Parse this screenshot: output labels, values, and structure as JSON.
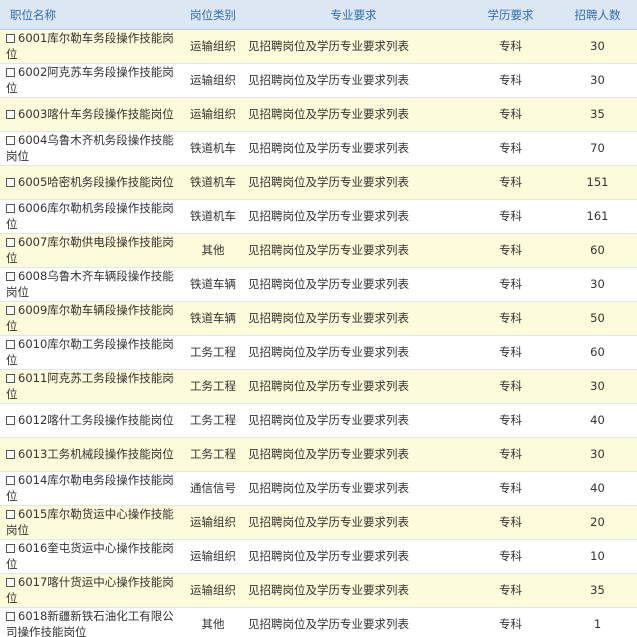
{
  "table": {
    "headers": {
      "name": "职位名称",
      "category": "岗位类别",
      "major": "专业要求",
      "education": "学历要求",
      "count": "招聘人数"
    },
    "rows": [
      {
        "name": "6001库尔勒车务段操作技能岗位",
        "category": "运输组织",
        "major": "见招聘岗位及学历专业要求列表",
        "education": "专科",
        "count": "30"
      },
      {
        "name": "6002阿克苏车务段操作技能岗位",
        "category": "运输组织",
        "major": "见招聘岗位及学历专业要求列表",
        "education": "专科",
        "count": "30"
      },
      {
        "name": "6003喀什车务段操作技能岗位",
        "category": "运输组织",
        "major": "见招聘岗位及学历专业要求列表",
        "education": "专科",
        "count": "35"
      },
      {
        "name": "6004乌鲁木齐机务段操作技能岗位",
        "category": "铁道机车",
        "major": "见招聘岗位及学历专业要求列表",
        "education": "专科",
        "count": "70"
      },
      {
        "name": "6005哈密机务段操作技能岗位",
        "category": "铁道机车",
        "major": "见招聘岗位及学历专业要求列表",
        "education": "专科",
        "count": "151"
      },
      {
        "name": "6006库尔勒机务段操作技能岗位",
        "category": "铁道机车",
        "major": "见招聘岗位及学历专业要求列表",
        "education": "专科",
        "count": "161"
      },
      {
        "name": "6007库尔勒供电段操作技能岗位",
        "category": "其他",
        "major": "见招聘岗位及学历专业要求列表",
        "education": "专科",
        "count": "60"
      },
      {
        "name": "6008乌鲁木齐车辆段操作技能岗位",
        "category": "铁道车辆",
        "major": "见招聘岗位及学历专业要求列表",
        "education": "专科",
        "count": "30"
      },
      {
        "name": "6009库尔勒车辆段操作技能岗位",
        "category": "铁道车辆",
        "major": "见招聘岗位及学历专业要求列表",
        "education": "专科",
        "count": "50"
      },
      {
        "name": "6010库尔勒工务段操作技能岗位",
        "category": "工务工程",
        "major": "见招聘岗位及学历专业要求列表",
        "education": "专科",
        "count": "60"
      },
      {
        "name": "6011阿克苏工务段操作技能岗位",
        "category": "工务工程",
        "major": "见招聘岗位及学历专业要求列表",
        "education": "专科",
        "count": "30"
      },
      {
        "name": "6012喀什工务段操作技能岗位",
        "category": "工务工程",
        "major": "见招聘岗位及学历专业要求列表",
        "education": "专科",
        "count": "40"
      },
      {
        "name": "6013工务机械段操作技能岗位",
        "category": "工务工程",
        "major": "见招聘岗位及学历专业要求列表",
        "education": "专科",
        "count": "30"
      },
      {
        "name": "6014库尔勒电务段操作技能岗位",
        "category": "通信信号",
        "major": "见招聘岗位及学历专业要求列表",
        "education": "专科",
        "count": "40"
      },
      {
        "name": "6015库尔勒货运中心操作技能岗位",
        "category": "运输组织",
        "major": "见招聘岗位及学历专业要求列表",
        "education": "专科",
        "count": "20"
      },
      {
        "name": "6016奎屯货运中心操作技能岗位",
        "category": "运输组织",
        "major": "见招聘岗位及学历专业要求列表",
        "education": "专科",
        "count": "10"
      },
      {
        "name": "6017喀什货运中心操作技能岗位",
        "category": "运输组织",
        "major": "见招聘岗位及学历专业要求列表",
        "education": "专科",
        "count": "35"
      },
      {
        "name": "6018新疆新铁石油化工有限公司操作技能岗位",
        "category": "其他",
        "major": "见招聘岗位及学历专业要求列表",
        "education": "专科",
        "count": "1"
      }
    ]
  }
}
